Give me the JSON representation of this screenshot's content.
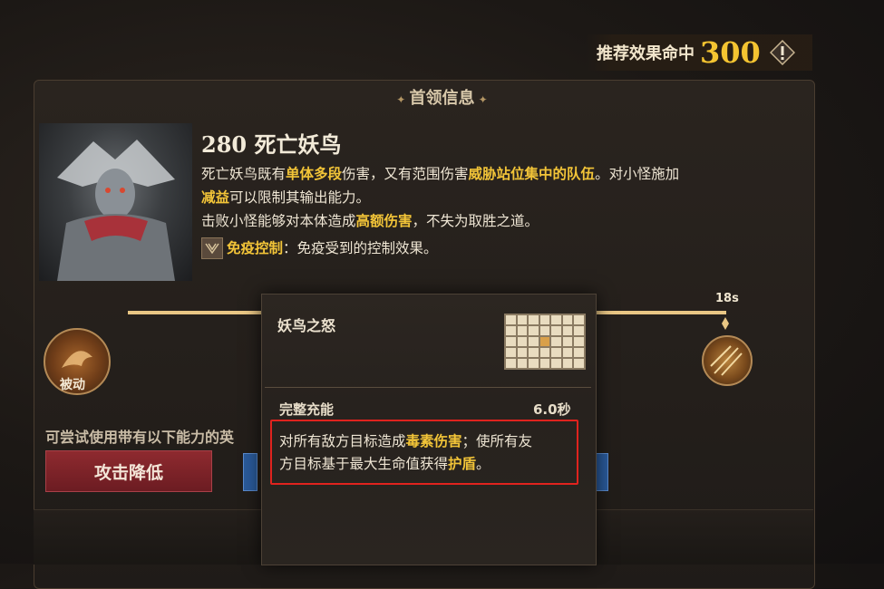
{
  "recommend": {
    "label": "推荐效果命中",
    "value": "300",
    "icon": "warning-icon"
  },
  "panel": {
    "title": "首领信息"
  },
  "boss": {
    "name": "280 死亡妖鸟",
    "desc1": {
      "a": "死亡妖鸟既有",
      "b": "单体多段",
      "c": "伤害，又有范围伤害",
      "d": "威胁站位集中的队伍",
      "e": "。对小怪施加"
    },
    "desc2": {
      "a": "减益",
      "b": "可以限制其输出能力。"
    },
    "desc3": {
      "a": "击败小怪能够对本体造成",
      "b": "高额伤害",
      "c": "，不失为取胜之道。"
    },
    "immune": {
      "name": "免疫控制",
      "text": "：免疫受到的控制效果。"
    }
  },
  "timeline": {
    "tick": "18s"
  },
  "passive": {
    "label": "被动"
  },
  "suggest": {
    "text": "可尝试使用带有以下能力的英",
    "button": "攻击降低"
  },
  "tooltip": {
    "title": "妖鸟之怒",
    "charge_label": "完整充能",
    "charge_value": "6.0秒",
    "effect1": {
      "a": "对所有敌方目标造成",
      "b": "毒素伤害",
      "c": "；使所有友"
    },
    "effect2": {
      "a": "方目标基于最大生命值获得",
      "b": "护盾",
      "c": "。"
    }
  },
  "colors": {
    "highlight": "#f2c438",
    "accent_gold": "#f4c431",
    "alert_red": "#e0231e",
    "button_red": "#8e2a2f"
  }
}
